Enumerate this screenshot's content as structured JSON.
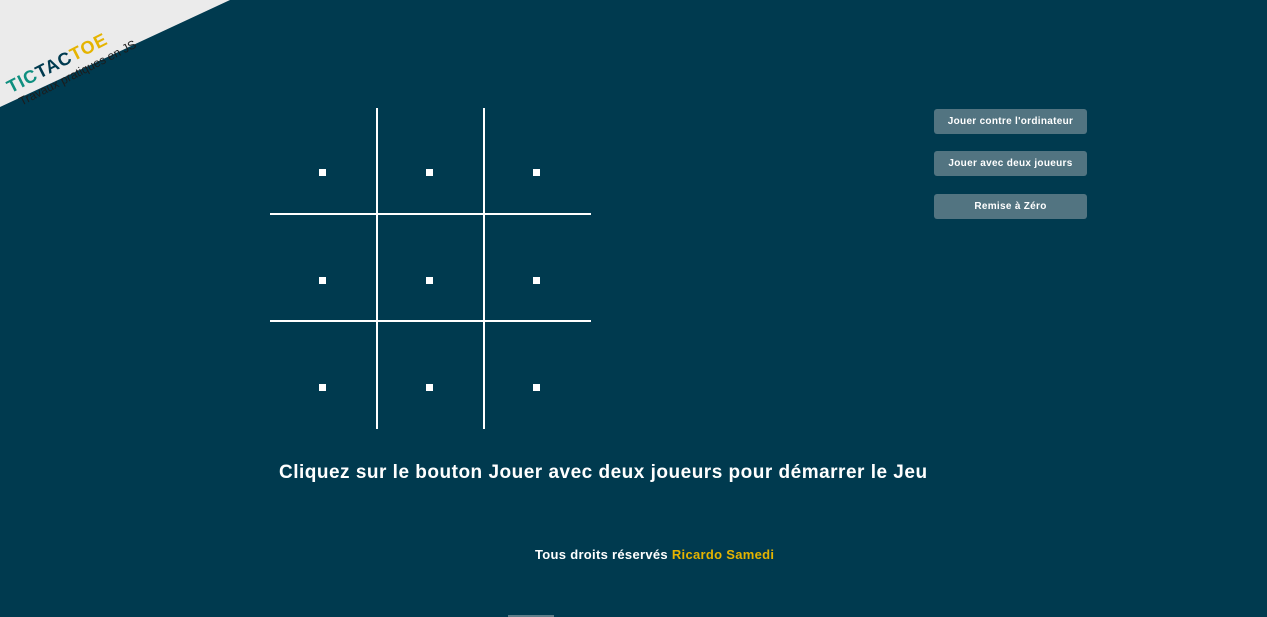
{
  "logo": {
    "part1": "TIC",
    "part2": "TAC",
    "part3": "TOE",
    "tagline": "Travaux pratiques en JS"
  },
  "board": {
    "cells": [
      "",
      "",
      "",
      "",
      "",
      "",
      "",
      "",
      ""
    ]
  },
  "buttons": {
    "vs_computer": "Jouer contre l'ordinateur",
    "two_players": "Jouer avec deux joueurs",
    "reset": "Remise à Zéro"
  },
  "message": "Cliquez sur le bouton Jouer avec deux joueurs pour démarrer le Jeu",
  "footer": {
    "rights": "Tous droits réservés",
    "author": "Ricardo Samedi"
  },
  "colors": {
    "background": "#003a4f",
    "ribbon": "#ebebeb",
    "button": "#527481",
    "accent": "#e5b400",
    "logo_teal": "#0f8f7f",
    "line": "#ffffff"
  }
}
